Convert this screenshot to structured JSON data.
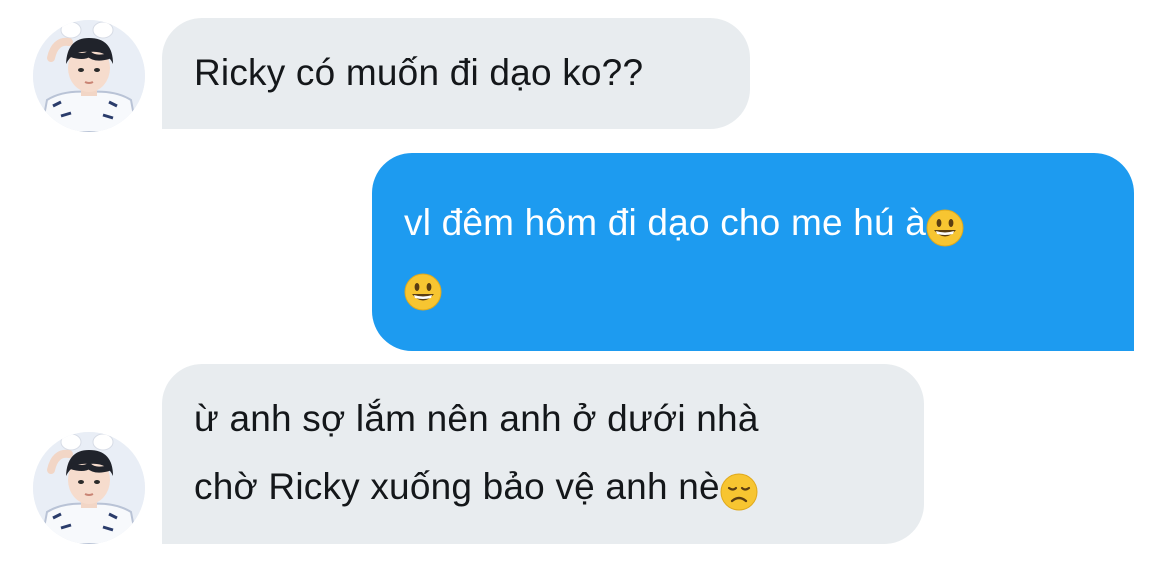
{
  "conversation": {
    "messages": [
      {
        "direction": "incoming",
        "lines": [
          "Ricky có muốn đi dạo ko??"
        ]
      },
      {
        "direction": "outgoing",
        "lines": [
          "vl đêm hôm đi dạo cho me hú à",
          ""
        ],
        "emojis": [
          "grinning-face",
          "grinning-face"
        ]
      },
      {
        "direction": "incoming",
        "lines": [
          "ừ anh sợ lắm nên anh ở dưới nhà",
          "chờ Ricky xuống bảo vệ anh nè"
        ],
        "emojis": [
          "disappointed-face"
        ]
      }
    ]
  },
  "colors": {
    "incoming_bubble": "#e8ecef",
    "outgoing_bubble": "#1d9bf0",
    "incoming_text": "#14171a",
    "outgoing_text": "#ffffff"
  }
}
